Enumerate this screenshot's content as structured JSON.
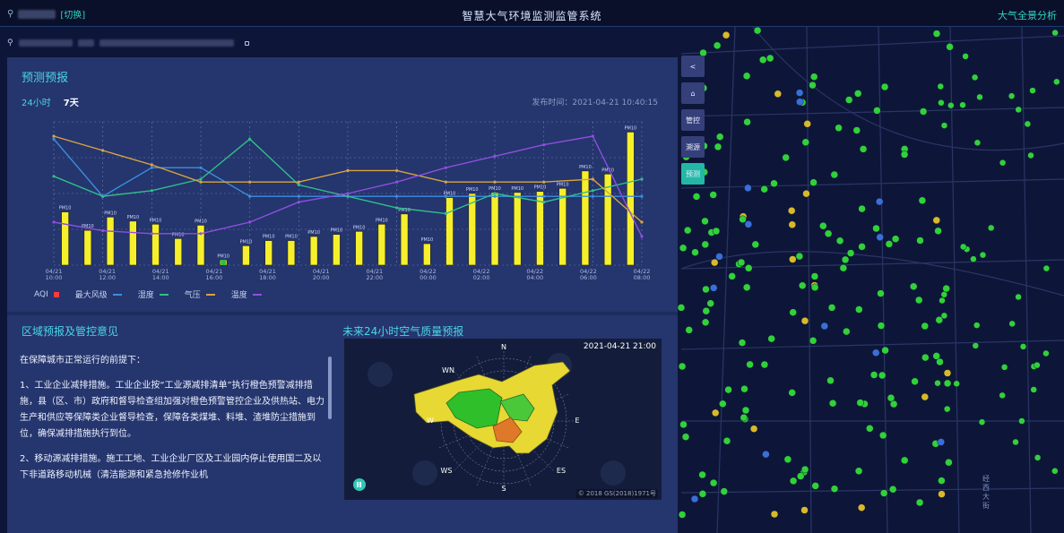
{
  "header": {
    "switch_label": "[切换]",
    "title": "智慧大气环境监测监管系统",
    "right_link": "大气全景分析"
  },
  "panel": {
    "title": "预测预报",
    "tabs": [
      {
        "label": "24小时",
        "active": false
      },
      {
        "label": "7天",
        "active": true
      }
    ],
    "release_time": "发布时间：2021-04-21 10:40:15"
  },
  "chart_data": {
    "type": "bar",
    "categories": [
      "04/21 10:00",
      "04/21 12:00",
      "04/21 14:00",
      "04/21 16:00",
      "04/21 18:00",
      "04/21 20:00",
      "04/21 22:00",
      "04/22 00:00",
      "04/22 02:00",
      "04/22 04:00",
      "04/22 06:00",
      "04/22 08:00"
    ],
    "x_tick_labels": [
      "04/21 10:00",
      "04/21 12:00",
      "04/21 14:00",
      "04/21 16:00",
      "04/21 18:00",
      "04/21 20:00",
      "04/21 22:00",
      "04/22 00:00",
      "04/22 02:00",
      "04/22 04:00",
      "04/22 06:00",
      "04/22 08:00"
    ],
    "bar_label": "PM10",
    "bars": [
      52,
      34,
      47,
      43,
      40,
      26,
      39,
      5,
      19,
      24,
      24,
      28,
      30,
      33,
      40,
      50,
      21,
      66,
      70,
      71,
      71,
      72,
      75,
      92,
      89,
      130
    ],
    "series": [
      {
        "name": "最大风级",
        "color": "#3a8fe0",
        "values": [
          88,
          48,
          68,
          68,
          48,
          48,
          48,
          48,
          48,
          48,
          48,
          48,
          48
        ]
      },
      {
        "name": "湿度",
        "color": "#2fbf8a",
        "values": [
          62,
          48,
          52,
          60,
          88,
          56,
          48,
          40,
          36,
          50,
          44,
          52,
          60
        ]
      },
      {
        "name": "气压",
        "color": "#d9a441",
        "values": [
          90,
          80,
          70,
          58,
          58,
          58,
          66,
          66,
          58,
          58,
          58,
          60,
          30
        ]
      },
      {
        "name": "温度",
        "color": "#8f4fe0",
        "values": [
          30,
          24,
          22,
          22,
          30,
          44,
          50,
          58,
          68,
          76,
          84,
          90,
          20
        ]
      }
    ],
    "legend": [
      {
        "label": "AQI",
        "color": "#ff3b3b"
      },
      {
        "label": "最大风级",
        "color": "#3a8fe0"
      },
      {
        "label": "湿度",
        "color": "#2fbf8a"
      },
      {
        "label": "气压",
        "color": "#d9a441"
      },
      {
        "label": "温度",
        "color": "#8f4fe0"
      }
    ],
    "grid": true
  },
  "advice": {
    "title": "区域预报及管控意见",
    "paragraphs": [
      "在保障城市正常运行的前提下：",
      "1、工业企业减排措施。工业企业按“工业源减排清单”执行橙色预警减排措施，县（区、市）政府和督导检查组加强对橙色预警管控企业及供热站、电力生产和供应等保障类企业督导检查，保障各类煤堆、料堆、渣堆防尘措施到位，确保减排措施执行到位。",
      "2、移动源减排措施。施工工地、工业企业厂区及工业园内停止使用国二及以下非道路移动机械（清洁能源和紧急抢修作业机"
    ]
  },
  "forecast": {
    "title": "未来24小时空气质量预报",
    "timestamp": "2021-04-21 21:00",
    "compass": [
      "N",
      "WN",
      "W",
      "WS",
      "S",
      "ES",
      "E"
    ],
    "copyright": "© 2018 GS(2018)1971号"
  },
  "toolbar": {
    "items": [
      {
        "label": "<",
        "active": false
      },
      {
        "label": "⌂",
        "active": false
      },
      {
        "label": "管控",
        "active": false
      },
      {
        "label": "溯源",
        "active": false
      },
      {
        "label": "预测",
        "active": true
      }
    ]
  },
  "map": {
    "label": "经西大街"
  }
}
